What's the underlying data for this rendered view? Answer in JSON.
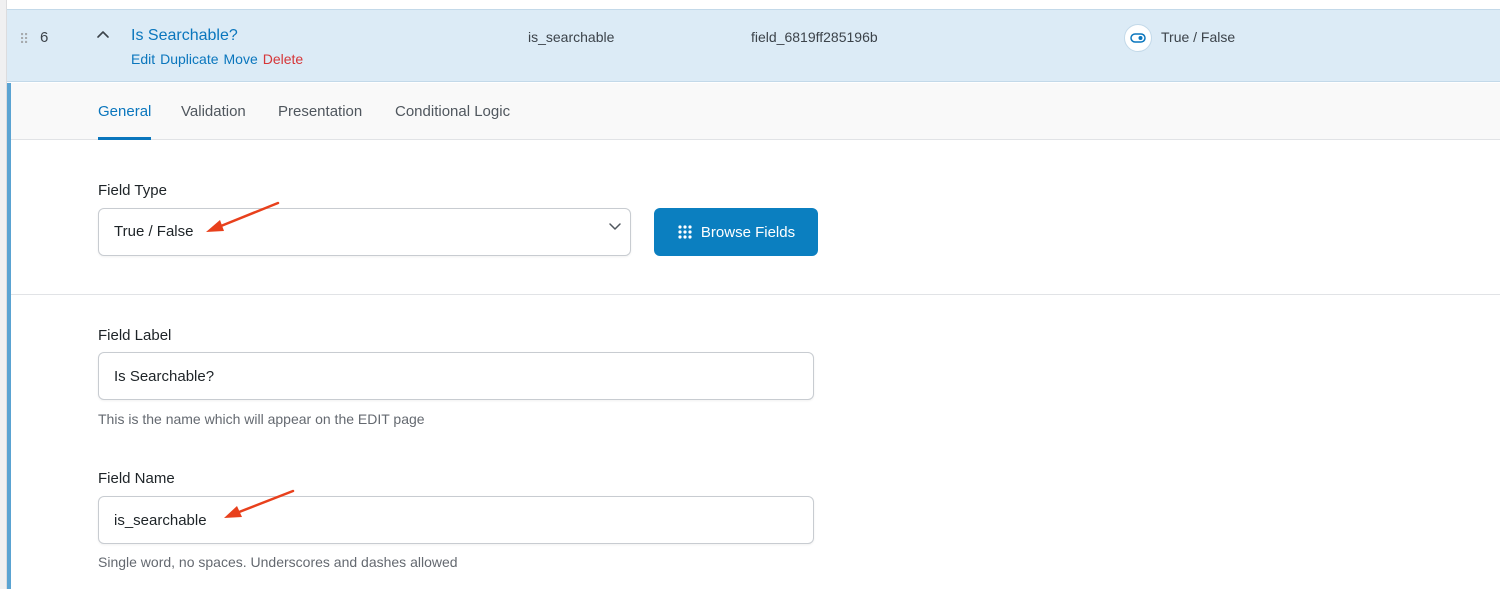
{
  "field_row": {
    "order": "6",
    "title": "Is Searchable?",
    "actions": {
      "edit": "Edit",
      "duplicate": "Duplicate",
      "move": "Move",
      "delete": "Delete"
    },
    "name": "is_searchable",
    "key": "field_6819ff285196b",
    "type": "True / False",
    "type_icon": "toggle-icon"
  },
  "tabs": [
    {
      "label": "General",
      "active": true
    },
    {
      "label": "Validation",
      "active": false
    },
    {
      "label": "Presentation",
      "active": false
    },
    {
      "label": "Conditional Logic",
      "active": false
    }
  ],
  "field_type": {
    "label": "Field Type",
    "value": "True / False",
    "browse_button": "Browse Fields"
  },
  "field_label": {
    "label": "Field Label",
    "value": "Is Searchable?",
    "hint": "This is the name which will appear on the EDIT page"
  },
  "field_name": {
    "label": "Field Name",
    "value": "is_searchable",
    "hint": "Single word, no spaces. Underscores and dashes allowed"
  },
  "colors": {
    "accent": "#0a76bd",
    "row_bg": "#dcebf6",
    "danger": "#d63638",
    "annotation_arrow": "#e8401c"
  }
}
